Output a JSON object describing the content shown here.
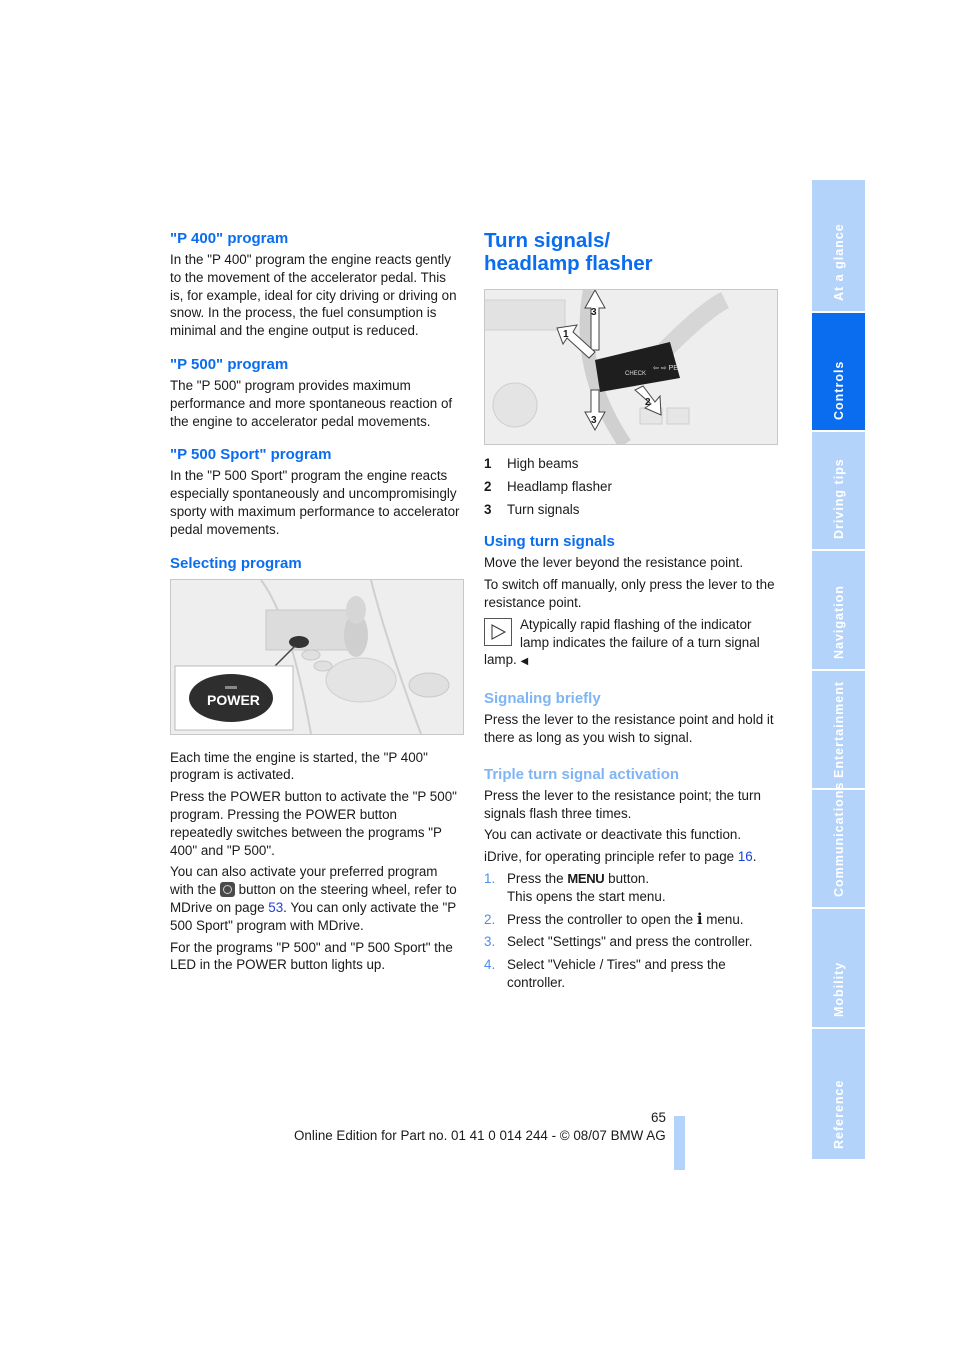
{
  "left_column": {
    "sections": [
      {
        "heading": "\"P 400\" program",
        "text": "In the \"P 400\" program the engine reacts gently to the movement of the accelerator pedal. This is, for example, ideal for city driving or driving on snow. In the process, the fuel consumption is minimal and the engine output is reduced."
      },
      {
        "heading": "\"P 500\" program",
        "text": "The \"P 500\" program provides maximum performance and more spontaneous reaction of the engine to accelerator pedal movements."
      },
      {
        "heading": "\"P 500 Sport\" program",
        "text": "In the \"P 500 Sport\" program the engine reacts especially spontaneously and uncompromisingly sporty with maximum performance to accelerator pedal movements."
      }
    ],
    "selecting": {
      "heading": "Selecting program",
      "figure_label": "POWER",
      "p1": "Each time the engine is started, the \"P 400\" program is activated.",
      "p2": "Press the POWER button to activate the \"P 500\" program. Pressing the POWER button repeatedly switches between the programs \"P 400\" and \"P 500\".",
      "p3_a": "You can also activate your preferred program with the",
      "p3_icon": "steering-wheel-mdrive-button-icon",
      "p3_b": "button on the steering wheel, refer to MDrive on page",
      "p3_link": "53",
      "p3_c": ". You can only activate the \"P 500 Sport\" program with MDrive.",
      "p4": "For the programs \"P 500\" and \"P 500 Sport\" the LED in the POWER button lights up."
    }
  },
  "right_column": {
    "title": "Turn signals/ headlamp flasher",
    "figure_labels": [
      "1",
      "2",
      "3",
      "3"
    ],
    "legend": [
      {
        "num": "1",
        "label": "High beams"
      },
      {
        "num": "2",
        "label": "Headlamp flasher"
      },
      {
        "num": "3",
        "label": "Turn signals"
      }
    ],
    "using": {
      "heading": "Using turn signals",
      "p1": "Move the lever beyond the resistance point.",
      "p2": "To switch off manually, only press the lever to the resistance point.",
      "note": "Atypically rapid flashing of the indicator lamp indicates the failure of a turn signal lamp.",
      "note_end": "◀"
    },
    "briefly": {
      "heading": "Signaling briefly",
      "text": "Press the lever to the resistance point and hold it there as long as you wish to signal."
    },
    "triple": {
      "heading": "Triple turn signal activation",
      "p1": "Press the lever to the resistance point; the turn signals flash three times.",
      "p2": "You can activate or deactivate this function.",
      "p3_a": "iDrive, for operating principle refer to page",
      "p3_link": "16",
      "p3_b": ".",
      "steps": [
        {
          "num": "1.",
          "a": "Press the",
          "glyph": "MENU",
          "b": "button.",
          "sub": "This opens the start menu."
        },
        {
          "num": "2.",
          "a": "Press the controller to open the",
          "glyph": "i",
          "b": "menu."
        },
        {
          "num": "3.",
          "a": "Select \"Settings\" and press the controller."
        },
        {
          "num": "4.",
          "a": "Select \"Vehicle / Tires\" and press the controller."
        }
      ]
    }
  },
  "side_tabs": [
    {
      "label": "At a glance",
      "active": false
    },
    {
      "label": "Controls",
      "active": true
    },
    {
      "label": "Driving tips",
      "active": false
    },
    {
      "label": "Navigation",
      "active": false
    },
    {
      "label": "Entertainment",
      "active": false
    },
    {
      "label": "Communications",
      "active": false
    },
    {
      "label": "Mobility",
      "active": false
    },
    {
      "label": "Reference",
      "active": false
    }
  ],
  "footer": {
    "page_number": "65",
    "edition": "Online Edition for Part no. 01 41 0 014 244 - © 08/07 BMW AG"
  },
  "colors": {
    "accent": "#0a6df0",
    "accent_light": "#b4d3fa",
    "link": "#1a3fe0"
  }
}
